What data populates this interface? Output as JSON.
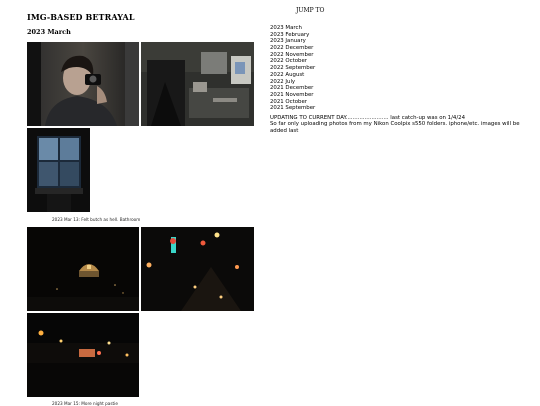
{
  "site": {
    "title": "IMG-BASED BETRAYAL"
  },
  "post": {
    "heading": "2023 March",
    "photo_groups": [
      {
        "photos": [
          {
            "alt": "mirror selfie",
            "icon": "photo-selfie"
          },
          {
            "alt": "desk with chair",
            "icon": "photo-desk"
          },
          {
            "alt": "bathroom window at night",
            "icon": "photo-window"
          }
        ],
        "caption": "2023 Mar 13: Felt butch as hell. Bathroom"
      },
      {
        "photos": [
          {
            "alt": "night dome",
            "icon": "photo-night-dome"
          },
          {
            "alt": "night street lights",
            "icon": "photo-night-street"
          },
          {
            "alt": "night city lights",
            "icon": "photo-night-city"
          }
        ],
        "caption": "2023 Mar 15: More night pastie"
      }
    ]
  },
  "jump": {
    "heading": "JUMP TO",
    "items": [
      "2023 March",
      "2023 February",
      "2023 January",
      "2022 December",
      "2022 November",
      "2022 October",
      "2022 September",
      "2022 August",
      "2022 July",
      "2021 December",
      "2021 November",
      "2021 October",
      "2021 September"
    ]
  },
  "notice": {
    "line1": "UPDATING TO CURRENT DAY......................... last catch-up was on 1/4/24",
    "line2": "So far only uploading photos from my Nikon Coolpix s550 folders. iphone/etc. images will be added last"
  }
}
